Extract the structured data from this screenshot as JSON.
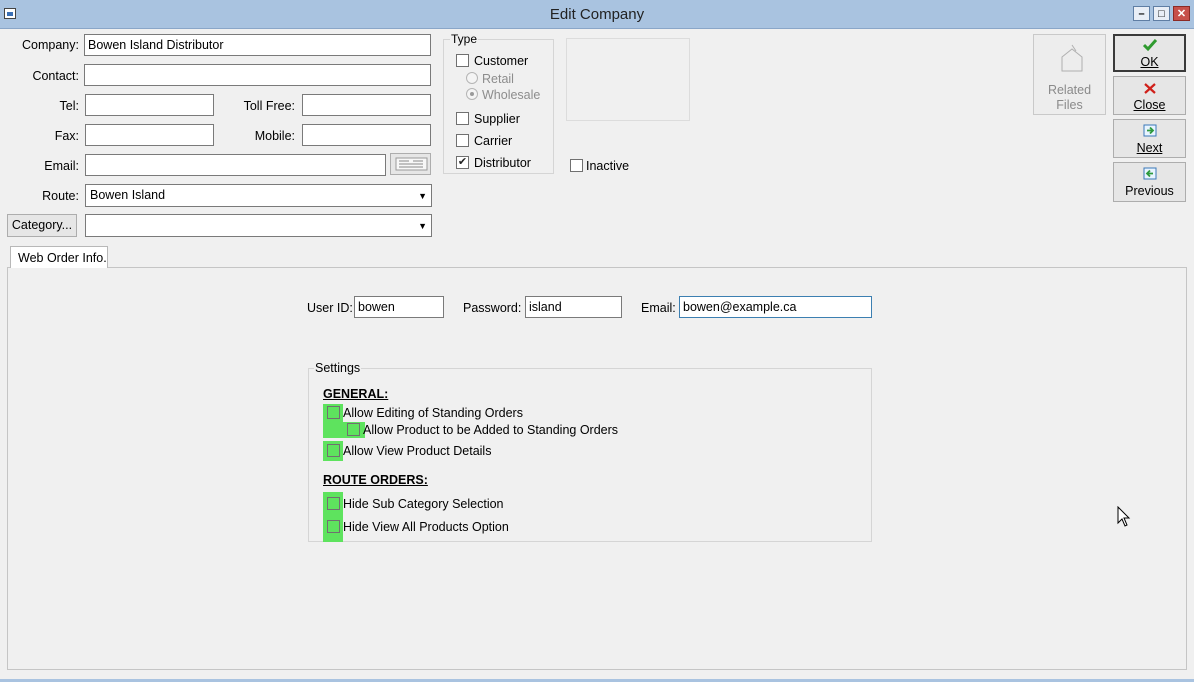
{
  "window": {
    "title": "Edit Company",
    "min_symbol": "–",
    "max_symbol": "□",
    "close_symbol": "✕"
  },
  "form": {
    "company_label": "Company:",
    "company_value": "Bowen Island Distributor",
    "contact_label": "Contact:",
    "contact_value": "",
    "tel_label": "Tel:",
    "tel_value": "",
    "tollfree_label": "Toll Free:",
    "tollfree_value": "",
    "fax_label": "Fax:",
    "fax_value": "",
    "mobile_label": "Mobile:",
    "mobile_value": "",
    "email_label": "Email:",
    "email_value": "",
    "route_label": "Route:",
    "route_value": "Bowen Island",
    "category_button": "Category...",
    "category_value": ""
  },
  "type_group": {
    "label": "Type",
    "customer": {
      "label": "Customer",
      "checked": false
    },
    "retail": {
      "label": "Retail",
      "selected": false
    },
    "wholesale": {
      "label": "Wholesale",
      "selected": true
    },
    "supplier": {
      "label": "Supplier",
      "checked": false
    },
    "carrier": {
      "label": "Carrier",
      "checked": false
    },
    "distributor": {
      "label": "Distributor",
      "checked": true
    }
  },
  "inactive": {
    "label": "Inactive",
    "checked": false
  },
  "buttons": {
    "related_files": {
      "line1": "Related",
      "line2": "Files"
    },
    "ok": "OK",
    "close": "Close",
    "next": "Next",
    "previous": "Previous"
  },
  "tabs": [
    {
      "label": "Web Order Info."
    }
  ],
  "web_order": {
    "userid_label": "User ID:",
    "userid_value": "bowen",
    "password_label": "Password:",
    "password_value": "island",
    "email_label": "Email:",
    "email_value": "bowen@example.ca"
  },
  "settings": {
    "label": "Settings",
    "general_heading": "GENERAL:",
    "allow_editing_standing_orders": "Allow Editing of Standing Orders",
    "allow_product_added": "Allow Product to be Added to Standing Orders",
    "allow_view_product_details": "Allow View Product Details",
    "route_orders_heading": "ROUTE ORDERS:",
    "hide_sub_category": "Hide Sub Category Selection",
    "hide_view_all_products": "Hide View All Products Option"
  },
  "colors": {
    "titlebar": "#a9c3e0",
    "highlight": "#5ee35e",
    "ok_check": "#2f9a2f",
    "close_x": "#d0201a"
  },
  "icons": {
    "ok": "check-icon",
    "close": "x-icon",
    "next": "next-arrow-icon",
    "previous": "previous-arrow-icon",
    "related_files": "related-files-icon",
    "email_button": "email-compose-icon"
  }
}
